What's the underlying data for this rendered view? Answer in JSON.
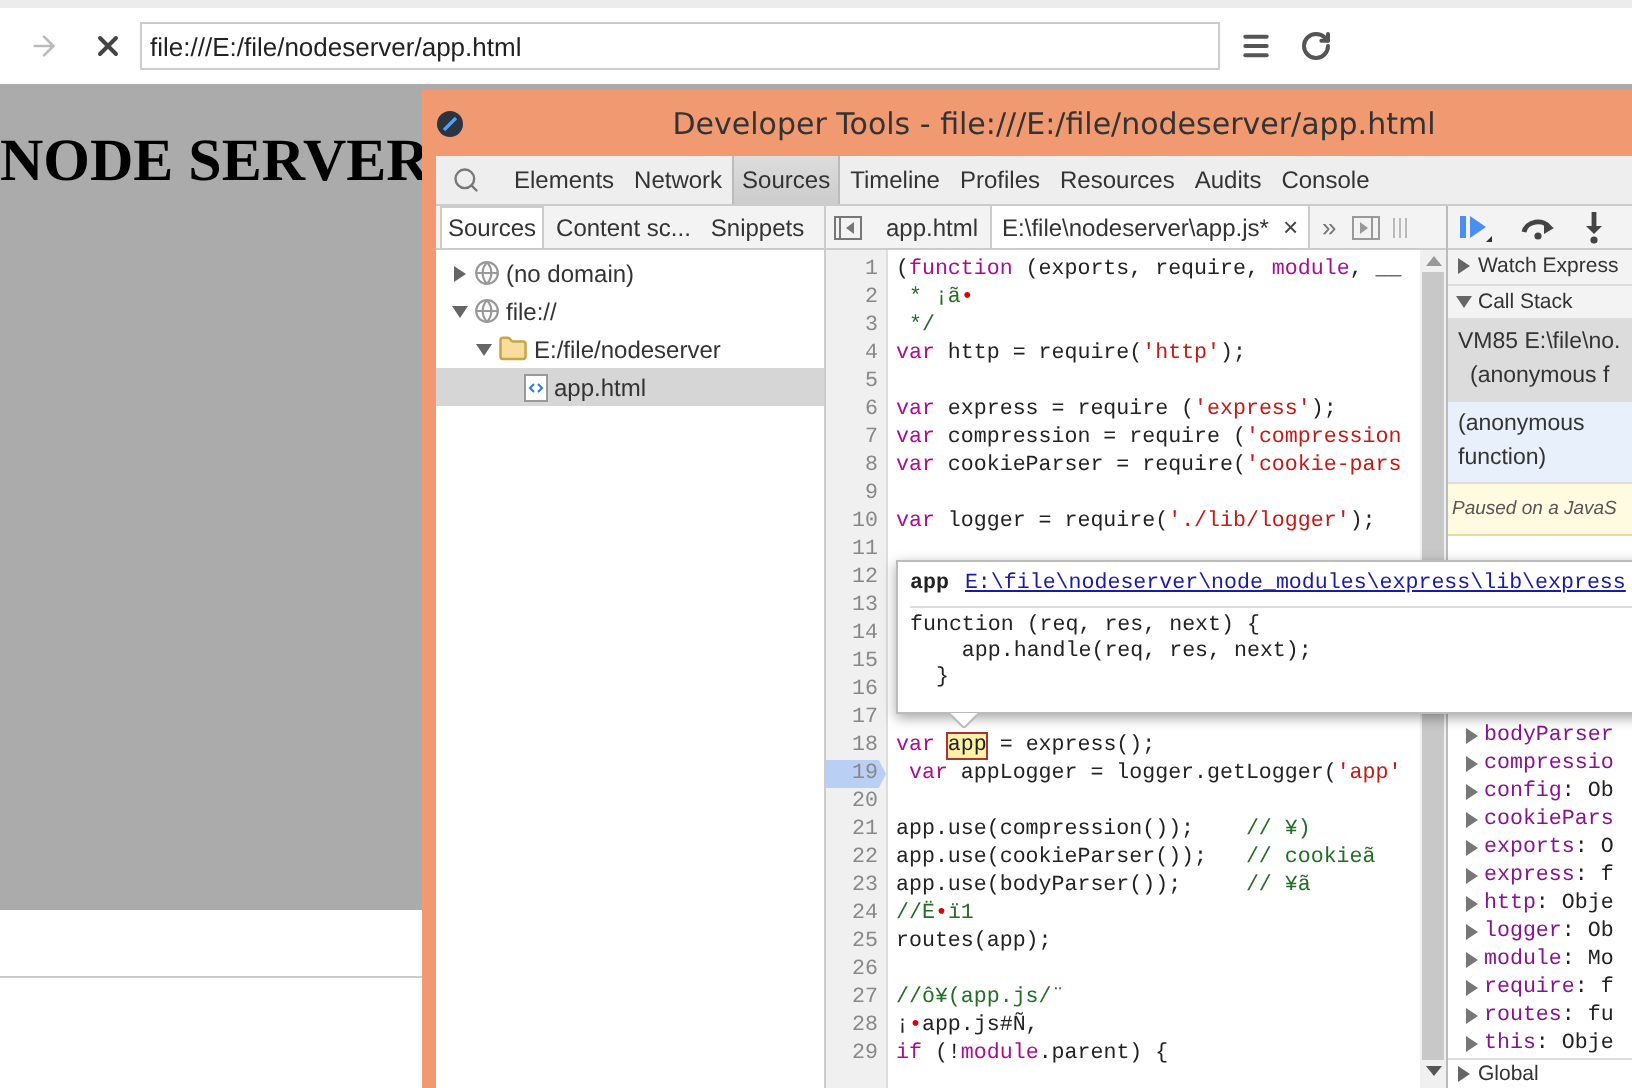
{
  "browser": {
    "address": "file:///E:/file/nodeserver/app.html"
  },
  "page": {
    "heading": "NODE SERVER"
  },
  "devtools": {
    "title": "Developer Tools - file:///E:/file/nodeserver/app.html",
    "panel_tabs": [
      {
        "label": "Elements",
        "selected": false
      },
      {
        "label": "Network",
        "selected": false
      },
      {
        "label": "Sources",
        "selected": true
      },
      {
        "label": "Timeline",
        "selected": false
      },
      {
        "label": "Profiles",
        "selected": false
      },
      {
        "label": "Resources",
        "selected": false
      },
      {
        "label": "Audits",
        "selected": false
      },
      {
        "label": "Console",
        "selected": false
      }
    ],
    "navigator": {
      "tabs": [
        {
          "label": "Sources",
          "selected": true
        },
        {
          "label": "Content sc...",
          "selected": false
        },
        {
          "label": "Snippets",
          "selected": false
        }
      ],
      "tree": [
        {
          "label": "(no domain)",
          "kind": "domain",
          "expanded": false,
          "selected": false
        },
        {
          "label": "file://",
          "kind": "domain",
          "expanded": true,
          "selected": false,
          "children": [
            {
              "label": "E:/file/nodeserver",
              "kind": "folder",
              "expanded": true,
              "selected": false,
              "children": [
                {
                  "label": "app.html",
                  "kind": "file",
                  "selected": true
                }
              ]
            }
          ]
        }
      ]
    },
    "editor": {
      "tabs": [
        {
          "label": "app.html",
          "selected": false
        },
        {
          "label": "E:\\file\\nodeserver\\app.js*",
          "selected": true,
          "close": "×"
        }
      ],
      "overflow": "»",
      "lines": [
        {
          "number": "1",
          "current": false,
          "tokens": [
            {
              "kind": "plain",
              "text": "("
            },
            {
              "kind": "keyword",
              "text": "function"
            },
            {
              "kind": "plain",
              "text": " (exports, require, "
            },
            {
              "kind": "keyword",
              "text": "module"
            },
            {
              "kind": "plain",
              "text": ", __"
            }
          ]
        },
        {
          "number": "2",
          "current": false,
          "tokens": [
            {
              "kind": "comment",
              "text": " * ¡ã"
            },
            {
              "kind": "mark",
              "text": "•"
            }
          ]
        },
        {
          "number": "3",
          "current": false,
          "tokens": [
            {
              "kind": "comment",
              "text": " */"
            }
          ]
        },
        {
          "number": "4",
          "current": false,
          "tokens": [
            {
              "kind": "keyword",
              "text": "var"
            },
            {
              "kind": "plain",
              "text": " http = require("
            },
            {
              "kind": "string",
              "text": "'http'"
            },
            {
              "kind": "plain",
              "text": ");"
            }
          ]
        },
        {
          "number": "5",
          "current": false
        },
        {
          "number": "6",
          "current": false,
          "tokens": [
            {
              "kind": "keyword",
              "text": "var"
            },
            {
              "kind": "plain",
              "text": " express = require ("
            },
            {
              "kind": "string",
              "text": "'express'"
            },
            {
              "kind": "plain",
              "text": ");"
            }
          ]
        },
        {
          "number": "7",
          "current": false,
          "tokens": [
            {
              "kind": "keyword",
              "text": "var"
            },
            {
              "kind": "plain",
              "text": " compression = require ("
            },
            {
              "kind": "string",
              "text": "'compression"
            }
          ]
        },
        {
          "number": "8",
          "current": false,
          "tokens": [
            {
              "kind": "keyword",
              "text": "var"
            },
            {
              "kind": "plain",
              "text": " cookieParser = require("
            },
            {
              "kind": "string",
              "text": "'cookie-pars"
            }
          ]
        },
        {
          "number": "9",
          "current": false
        },
        {
          "number": "10",
          "current": false,
          "tokens": [
            {
              "kind": "keyword",
              "text": "var"
            },
            {
              "kind": "plain",
              "text": " logger = require("
            },
            {
              "kind": "string",
              "text": "'./lib/logger'"
            },
            {
              "kind": "plain",
              "text": ");"
            }
          ]
        },
        {
          "number": "11",
          "current": false
        },
        {
          "number": "12",
          "current": false
        },
        {
          "number": "13",
          "current": false
        },
        {
          "number": "14",
          "current": false
        },
        {
          "number": "15",
          "current": false
        },
        {
          "number": "16",
          "current": false
        },
        {
          "number": "17",
          "current": false
        },
        {
          "number": "18",
          "current": false,
          "tokens": [
            {
              "kind": "keyword",
              "text": "var "
            },
            {
              "kind": "highlight",
              "text": "app"
            },
            {
              "kind": "plain",
              "text": " = express();"
            }
          ]
        },
        {
          "number": "19",
          "current": true,
          "tokens": [
            {
              "kind": "keyword",
              "text": " var"
            },
            {
              "kind": "plain",
              "text": " appLogger = logger.getLogger("
            },
            {
              "kind": "string",
              "text": "'app'"
            }
          ]
        },
        {
          "number": "20",
          "current": false
        },
        {
          "number": "21",
          "current": false,
          "tokens": [
            {
              "kind": "plain",
              "text": "app.use(compression());    "
            },
            {
              "kind": "comment",
              "text": "// ¥)"
            }
          ]
        },
        {
          "number": "22",
          "current": false,
          "tokens": [
            {
              "kind": "plain",
              "text": "app.use(cookieParser());   "
            },
            {
              "kind": "comment",
              "text": "// cookieã"
            }
          ]
        },
        {
          "number": "23",
          "current": false,
          "tokens": [
            {
              "kind": "plain",
              "text": "app.use(bodyParser());     "
            },
            {
              "kind": "comment",
              "text": "// ¥ã"
            }
          ]
        },
        {
          "number": "24",
          "current": false,
          "tokens": [
            {
              "kind": "comment",
              "text": "//Ë"
            },
            {
              "kind": "mark",
              "text": "•"
            },
            {
              "kind": "comment",
              "text": "ï1"
            }
          ]
        },
        {
          "number": "25",
          "current": false,
          "tokens": [
            {
              "kind": "plain",
              "text": "routes(app);"
            }
          ]
        },
        {
          "number": "26",
          "current": false
        },
        {
          "number": "27",
          "current": false,
          "tokens": [
            {
              "kind": "comment",
              "text": "//ô¥(app.js/¨"
            }
          ]
        },
        {
          "number": "28",
          "current": false,
          "tokens": [
            {
              "kind": "plain",
              "text": "¡"
            },
            {
              "kind": "mark",
              "text": "•"
            },
            {
              "kind": "plain",
              "text": "app.js#Ñ,"
            }
          ]
        },
        {
          "number": "29",
          "current": false,
          "tokens": [
            {
              "kind": "keyword",
              "text": "if"
            },
            {
              "kind": "plain",
              "text": " (!"
            },
            {
              "kind": "keyword",
              "text": "module"
            },
            {
              "kind": "plain",
              "text": ".parent) {"
            }
          ]
        }
      ]
    },
    "tooltip": {
      "name": "app",
      "link": "E:\\file\\nodeserver\\node_modules\\express\\lib\\express",
      "lines": [
        "function (req, res, next) {",
        "    app.handle(req, res, next);",
        "  }"
      ]
    },
    "sidebar": {
      "watch": {
        "label": "Watch Express",
        "expanded": false
      },
      "call_stack": {
        "label": "Call Stack",
        "expanded": true,
        "frames": [
          {
            "location": "VM85 E:\\file\\no.",
            "name": "(anonymous f",
            "selected": true,
            "hovered": false
          },
          {
            "name": "(anonymous function)",
            "selected": false,
            "hovered": true
          }
        ]
      },
      "paused_message": "Paused on a JavaS",
      "scope_variables": [
        {
          "name": "bodyParser"
        },
        {
          "name": "compressio"
        },
        {
          "name": "config",
          "rest": ": Ob"
        },
        {
          "name": "cookiePars"
        },
        {
          "name": "exports",
          "rest": ": O"
        },
        {
          "name": "express",
          "rest": ": f"
        },
        {
          "name": "http",
          "rest": ": Obje"
        },
        {
          "name": "logger",
          "rest": ": Ob"
        },
        {
          "name": "module",
          "rest": ": Mo"
        },
        {
          "name": "require",
          "rest": ": f"
        },
        {
          "name": "routes",
          "rest": ": fu"
        },
        {
          "name": "this",
          "rest": ": Obje"
        }
      ],
      "global": {
        "label": "Global",
        "expanded": false
      }
    }
  }
}
